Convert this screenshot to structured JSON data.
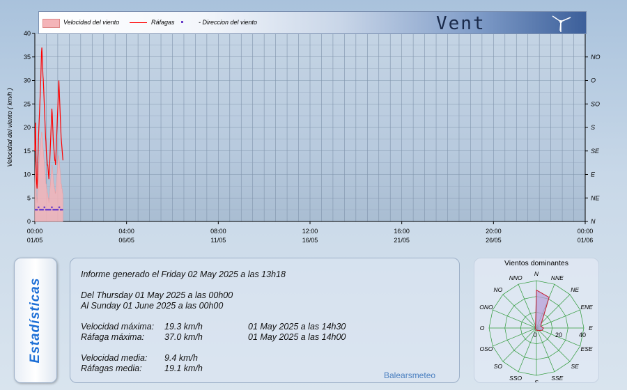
{
  "legend": {
    "items": [
      "Velocidad del viento",
      "Ráfagas",
      "- Direccion del viento"
    ],
    "colors": {
      "speed_fill": "#f4b4b8",
      "gust_line": "#ff0000",
      "dir_dot": "#6a3fc9"
    }
  },
  "header": {
    "title": "Vent"
  },
  "chart_data": {
    "type": "area",
    "ylabel": "Velocidad del viento ( km/h )",
    "ylim": [
      0,
      40
    ],
    "y_ticks": [
      0,
      5,
      10,
      15,
      20,
      25,
      30,
      35,
      40
    ],
    "y2_ticks": [
      "N",
      "NE",
      "E",
      "SE",
      "S",
      "SO",
      "O",
      "NO"
    ],
    "x_ticks": [
      {
        "time": "00:00",
        "date": "01/05"
      },
      {
        "time": "04:00",
        "date": "06/05"
      },
      {
        "time": "08:00",
        "date": "11/05"
      },
      {
        "time": "12:00",
        "date": "16/05"
      },
      {
        "time": "16:00",
        "date": "21/05"
      },
      {
        "time": "20:00",
        "date": "26/05"
      },
      {
        "time": "00:00",
        "date": "01/06"
      }
    ],
    "x_range_hours": [
      0,
      744
    ],
    "series": [
      {
        "name": "Velocidad del viento",
        "x_hours": [
          0,
          0.5,
          1,
          1.5,
          2,
          2.5,
          3,
          3.5,
          4,
          4.5,
          5,
          5.5,
          6,
          6.5,
          7,
          7.5,
          8,
          8.5,
          9,
          9.5,
          10,
          10.5,
          11,
          11.5,
          12,
          12.5,
          13,
          13.5,
          14,
          14.5,
          15,
          15.5,
          16,
          16.5,
          17,
          17.5,
          18,
          18.5,
          19,
          19.5,
          20,
          20.5,
          21,
          21.5,
          22,
          22.5,
          23,
          23.5,
          24,
          24.5,
          25,
          25.5,
          26,
          26.5,
          27,
          27.5,
          28,
          28.5,
          29,
          29.5,
          30,
          30.5,
          31,
          31.5,
          32,
          32.5,
          33,
          33.5,
          34,
          34.5,
          35,
          35.5,
          36,
          36.5,
          37,
          37.5,
          38
        ],
        "values": [
          8,
          12,
          14,
          9,
          6,
          5,
          4,
          5,
          7,
          8,
          10,
          12,
          13,
          14,
          15,
          16,
          17,
          18,
          19,
          19,
          18,
          17,
          16,
          15,
          14,
          13,
          12,
          11,
          10,
          9,
          8,
          8,
          7,
          7,
          6,
          6,
          5,
          5,
          4,
          5,
          6,
          7,
          8,
          9,
          10,
          11,
          12,
          12,
          11,
          10,
          9,
          8,
          8,
          7,
          7,
          6,
          6,
          7,
          8,
          9,
          10,
          11,
          12,
          13,
          14,
          14,
          13,
          12,
          11,
          10,
          9,
          8,
          8,
          7,
          7,
          6,
          6
        ]
      },
      {
        "name": "Ráfagas",
        "x_hours": [
          0,
          0.5,
          1,
          1.5,
          2,
          2.5,
          3,
          3.5,
          4,
          4.5,
          5,
          5.5,
          6,
          6.5,
          7,
          7.5,
          8,
          8.5,
          9,
          9.5,
          10,
          10.5,
          11,
          11.5,
          12,
          12.5,
          13,
          13.5,
          14,
          14.5,
          15,
          15.5,
          16,
          16.5,
          17,
          17.5,
          18,
          18.5,
          19,
          19.5,
          20,
          20.5,
          21,
          21.5,
          22,
          22.5,
          23,
          23.5,
          24,
          24.5,
          25,
          25.5,
          26,
          26.5,
          27,
          27.5,
          28,
          28.5,
          29,
          29.5,
          30,
          30.5,
          31,
          31.5,
          32,
          32.5,
          33,
          33.5,
          34,
          34.5,
          35,
          35.5,
          36,
          36.5,
          37,
          37.5,
          38
        ],
        "values": [
          15,
          20,
          21,
          14,
          10,
          8,
          7,
          9,
          13,
          15,
          18,
          20,
          22,
          24,
          26,
          28,
          30,
          33,
          36,
          37,
          35,
          33,
          31,
          30,
          28,
          26,
          24,
          22,
          20,
          18,
          17,
          15,
          14,
          13,
          12,
          12,
          11,
          10,
          9,
          11,
          12,
          14,
          16,
          18,
          20,
          22,
          24,
          23,
          21,
          19,
          17,
          16,
          15,
          14,
          13,
          13,
          12,
          14,
          16,
          18,
          20,
          22,
          24,
          26,
          28,
          30,
          28,
          26,
          24,
          22,
          20,
          18,
          17,
          16,
          15,
          14,
          13
        ]
      },
      {
        "name": "- Direccion del viento",
        "x_hours": [
          1,
          3,
          5,
          7,
          9,
          11,
          13,
          15,
          17,
          19,
          21,
          23,
          25,
          27,
          29,
          31,
          33,
          35,
          37
        ],
        "values": [
          2.5,
          2.5,
          3,
          2.5,
          2.5,
          2.5,
          3,
          2.5,
          2.5,
          2.5,
          2.5,
          3,
          2.5,
          2.5,
          2.5,
          2.5,
          3,
          2.5,
          2.5
        ]
      }
    ]
  },
  "stats": {
    "tab_label": "Estadísticas",
    "generated": "Informe generado el Friday 02 May 2025 a las 13h18",
    "from": "Del Thursday 01 May 2025 a las 00h00",
    "to": "Al Sunday 01 June 2025 a las 00h00",
    "max_speed_label": "Velocidad máxima:",
    "max_speed_value": "19.3 km/h",
    "max_speed_when": "01 May 2025 a las 14h30",
    "max_gust_label": "Ráfaga máxima:",
    "max_gust_value": "37.0 km/h",
    "max_gust_when": "01 May 2025 a las 14h00",
    "avg_speed_label": "Velocidad media:",
    "avg_speed_value": "9.4 km/h",
    "avg_gust_label": "Ráfagas media:",
    "avg_gust_value": "19.1 km/h",
    "brand": "Balearsmeteo"
  },
  "rose": {
    "title": "Vientos dominantes",
    "directions": [
      "N",
      "NNE",
      "NE",
      "ENE",
      "E",
      "ESE",
      "SE",
      "SSE",
      "S",
      "SSO",
      "SO",
      "OSO",
      "O",
      "ONO",
      "NO",
      "NNO"
    ],
    "scale_labels": [
      "0",
      "20",
      "40"
    ],
    "values": [
      32,
      28,
      6,
      4,
      6,
      5,
      3,
      2,
      2,
      1,
      1,
      1,
      1,
      1,
      1,
      2
    ],
    "colors": {
      "fill": "#b8a0d8",
      "stroke": "#c0182a",
      "grid": "#2f9a3a"
    }
  }
}
